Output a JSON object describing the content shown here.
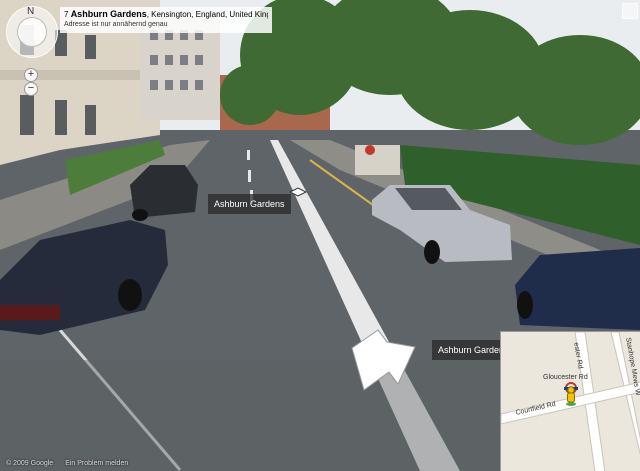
{
  "address": {
    "number": "7",
    "street": "Ashburn Gardens",
    "locality": ", Kensington, England, United Kingdom",
    "note": "Adresse ist nur annähernd genau"
  },
  "street_labels": {
    "center": "Ashburn Gardens",
    "right": "Ashburn Gardens"
  },
  "minimap": {
    "gloucester_rd": "Gloucester Rd",
    "courtfield_rd": "Courtfield Rd",
    "ester_rd": "ester Rd",
    "mews": "Stanhope Mews W"
  },
  "footer": {
    "copyright": "© 2009 Google",
    "report": "Ein Problem melden"
  },
  "nav": {
    "north": "N",
    "zoom_in": "+",
    "zoom_out": "−"
  },
  "colors": {
    "sky": "#e9edf0",
    "road": "#5f6468",
    "trees": "#3f6a33",
    "minimap_bg": "#ece7dd",
    "metro": "#f2c400"
  }
}
